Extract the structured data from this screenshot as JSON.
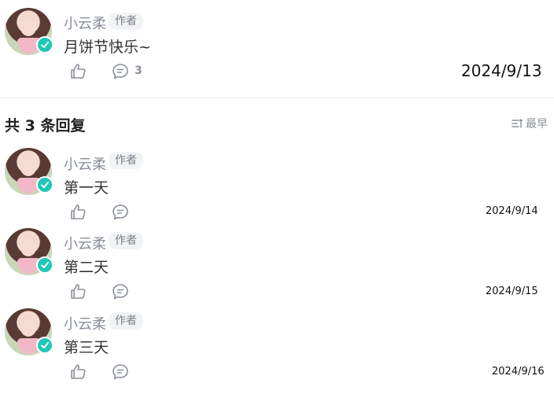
{
  "main_comment": {
    "author": "小云柔",
    "badge": "作者",
    "text": "月饼节快乐~",
    "reply_count": "3",
    "date": "2024/9/13"
  },
  "replies_section": {
    "title": "共 3 条回复",
    "sort_label": "最早"
  },
  "replies": [
    {
      "author": "小云柔",
      "badge": "作者",
      "text": "第一天",
      "date": "2024/9/14"
    },
    {
      "author": "小云柔",
      "badge": "作者",
      "text": "第二天",
      "date": "2024/9/15"
    },
    {
      "author": "小云柔",
      "badge": "作者",
      "text": "第三天",
      "date": "2024/9/16"
    }
  ],
  "icons": {
    "verified": "check-circle-icon",
    "like": "thumbs-up-icon",
    "comment": "comment-bubble-icon",
    "sort": "sort-icon"
  },
  "colors": {
    "verified": "#1fc7b6",
    "muted_text": "#8a8f99"
  }
}
